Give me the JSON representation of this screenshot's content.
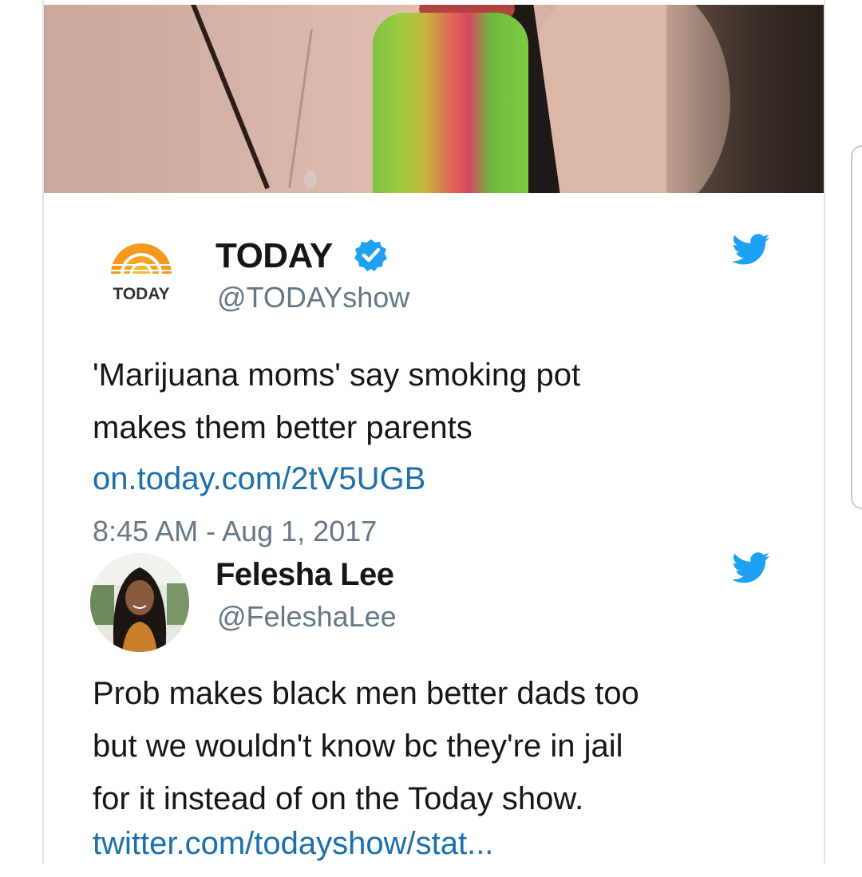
{
  "tweets": [
    {
      "name": "TODAY",
      "handle": "@TODAYshow",
      "verified": true,
      "avatar_logo_text": "TODAY",
      "text_lines": [
        "'Marijuana moms' say smoking pot",
        "makes them better parents"
      ],
      "link": "on.today.com/2tV5UGB",
      "timestamp": "8:45 AM - Aug 1, 2017"
    },
    {
      "name": "Felesha Lee",
      "handle": "@FeleshaLee",
      "verified": false,
      "text_lines": [
        "Prob makes black men better dads too",
        "but we wouldn't know bc they're in jail",
        "for it instead of on the Today show."
      ],
      "link": "twitter.com/todayshow/stat..."
    }
  ],
  "icons": {
    "twitter_bird": "twitter-bird-icon",
    "verified_badge": "verified-badge-icon"
  },
  "colors": {
    "twitter_blue": "#1da1f2",
    "link": "#1b6faa",
    "text": "#14171a",
    "muted": "#657786",
    "today_orange": "#f39a1e"
  }
}
